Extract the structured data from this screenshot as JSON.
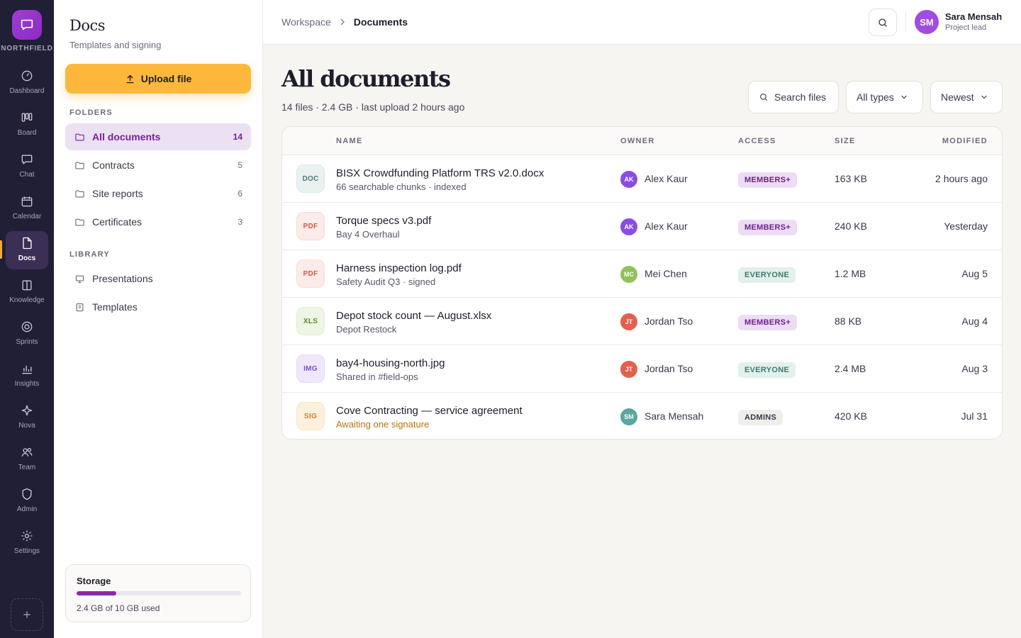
{
  "brand": {
    "name": "NORTHFIELD"
  },
  "rail": {
    "items": [
      {
        "label": "Dashboard",
        "icon": "dashboard-icon"
      },
      {
        "label": "Board",
        "icon": "board-icon"
      },
      {
        "label": "Chat",
        "icon": "chat-icon"
      },
      {
        "label": "Calendar",
        "icon": "calendar-icon"
      },
      {
        "label": "Docs",
        "icon": "docs-icon",
        "active": true
      },
      {
        "label": "Knowledge",
        "icon": "book-icon"
      },
      {
        "label": "Sprints",
        "icon": "target-icon"
      },
      {
        "label": "Insights",
        "icon": "bar-chart-icon"
      },
      {
        "label": "Nova",
        "icon": "sparkle-icon"
      },
      {
        "label": "Team",
        "icon": "team-icon"
      },
      {
        "label": "Admin",
        "icon": "shield-icon"
      },
      {
        "label": "Settings",
        "icon": "gear-icon"
      }
    ]
  },
  "side": {
    "title": "Docs",
    "subtitle": "Templates and signing",
    "upload_label": "Upload file",
    "folders_label": "FOLDERS",
    "folders": [
      {
        "name": "All documents",
        "count": "14",
        "active": true
      },
      {
        "name": "Contracts",
        "count": "5"
      },
      {
        "name": "Site reports",
        "count": "6"
      },
      {
        "name": "Certificates",
        "count": "3"
      }
    ],
    "library_label": "LIBRARY",
    "library": [
      {
        "name": "Presentations",
        "icon": "presentation-icon"
      },
      {
        "name": "Templates",
        "icon": "template-icon"
      }
    ],
    "storage": {
      "title": "Storage",
      "text": "2.4 GB of 10 GB used",
      "used_fraction": 0.24
    }
  },
  "topbar": {
    "crumb_parent": "Workspace",
    "crumb_current": "Documents",
    "user": {
      "initials": "SM",
      "name": "Sara Mensah",
      "role": "Project lead"
    }
  },
  "main": {
    "title": "All documents",
    "meta": "14 files · 2.4 GB · last upload 2 hours ago",
    "search_placeholder": "Search files",
    "type_filter": "All types",
    "sort": "Newest",
    "columns": {
      "name": "NAME",
      "owner": "OWNER",
      "access": "ACCESS",
      "size": "SIZE",
      "modified": "MODIFIED"
    },
    "rows": [
      {
        "type": "DOC",
        "name": "BISX Crowdfunding Platform TRS v2.0.docx",
        "sub": "66 searchable chunks · indexed",
        "owner_initials": "AK",
        "owner": "Alex Kaur",
        "access": "MEMBERS+",
        "size": "163 KB",
        "modified": "2 hours ago"
      },
      {
        "type": "PDF",
        "name": "Torque specs v3.pdf",
        "sub": "Bay 4 Overhaul",
        "owner_initials": "AK",
        "owner": "Alex Kaur",
        "access": "MEMBERS+",
        "size": "240 KB",
        "modified": "Yesterday"
      },
      {
        "type": "PDF",
        "name": "Harness inspection log.pdf",
        "sub": "Safety Audit Q3 · signed",
        "owner_initials": "MC",
        "owner": "Mei Chen",
        "access": "EVERYONE",
        "size": "1.2 MB",
        "modified": "Aug 5"
      },
      {
        "type": "XLS",
        "name": "Depot stock count — August.xlsx",
        "sub": "Depot Restock",
        "owner_initials": "JT",
        "owner": "Jordan Tso",
        "access": "MEMBERS+",
        "size": "88 KB",
        "modified": "Aug 4"
      },
      {
        "type": "IMG",
        "name": "bay4-housing-north.jpg",
        "sub": "Shared in #field-ops",
        "owner_initials": "JT",
        "owner": "Jordan Tso",
        "access": "EVERYONE",
        "size": "2.4 MB",
        "modified": "Aug 3"
      },
      {
        "type": "SIG",
        "name": "Cove Contracting — service agreement",
        "sub": "Awaiting one signature",
        "sub_status": "warning",
        "owner_initials": "SM",
        "owner": "Sara Mensah",
        "access": "ADMINS",
        "size": "420 KB",
        "modified": "Jul 31"
      }
    ]
  },
  "colors": {
    "accent": "#8e24aa",
    "upload": "#fdb73b",
    "rail_bg": "#211f35",
    "avatar_AK": "#8b4ce6",
    "avatar_MC": "#8fc25a",
    "avatar_JT": "#e2604e",
    "avatar_SM": "#5aa6a0"
  }
}
